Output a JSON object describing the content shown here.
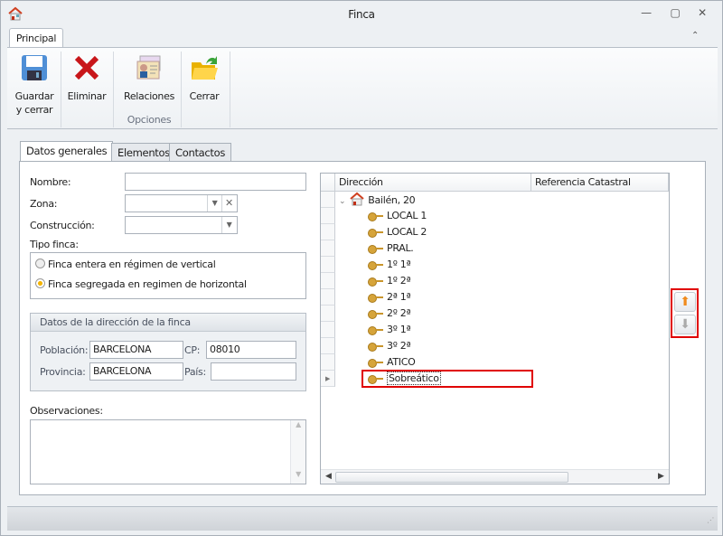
{
  "window": {
    "title": "Finca",
    "min": "—",
    "max": "▢",
    "close": "✕"
  },
  "ribbon": {
    "tab": "Principal",
    "collapse": "⌃",
    "buttons": [
      {
        "label1": "Guardar",
        "label2": "y cerrar"
      },
      {
        "label1": "Eliminar"
      },
      {
        "label1": "Relaciones"
      },
      {
        "label1": "Cerrar"
      }
    ],
    "group": "Opciones"
  },
  "tabs": [
    "Datos generales",
    "Elementos",
    "Contactos"
  ],
  "form": {
    "nombre_label": "Nombre:",
    "nombre": "",
    "zona_label": "Zona:",
    "zona": "",
    "construccion_label": "Construcción:",
    "construccion": "",
    "tipo_label": "Tipo finca:",
    "radio1": "Finca entera en régimen de vertical",
    "radio2": "Finca segregada en regimen de horizontal",
    "selected": 2,
    "dir_group": "Datos de la dirección de la finca",
    "poblacion_label": "Población:",
    "poblacion": "BARCELONA",
    "cp_label": "CP:",
    "cp": "08010",
    "provincia_label": "Provincia:",
    "provincia": "BARCELONA",
    "pais_label": "País:",
    "pais": "",
    "obs_label": "Observaciones:",
    "obs": ""
  },
  "grid": {
    "columns": [
      "Dirección",
      "Referencia Catastral"
    ],
    "root": "Bailén, 20",
    "items": [
      "LOCAL 1",
      "LOCAL 2",
      "PRAL.",
      "1º 1ª",
      "1º 2ª",
      "2ª 1ª",
      "2º 2ª",
      "3º 1ª",
      "3º 2ª",
      "ATICO",
      "Sobreático"
    ],
    "selected": "Sobreático"
  },
  "colors": {
    "highlight": "#e00000",
    "accent_up": "#f08a1c"
  }
}
